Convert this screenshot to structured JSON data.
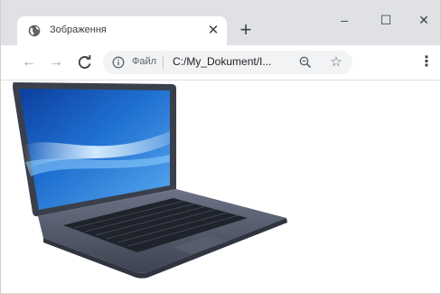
{
  "tab": {
    "title": "Зображення",
    "close_icon": "close-icon",
    "favicon": "globe-icon"
  },
  "new_tab_label": "+",
  "window_controls": {
    "minimize": "–",
    "maximize": "☐",
    "close": "✕"
  },
  "toolbar": {
    "back": "←",
    "forward": "→",
    "reload": "C",
    "scheme_label": "Файл",
    "url": "C:/My_Dokument/I...",
    "star": "☆",
    "menu": "⋮"
  },
  "content": {
    "image_subject": "laptop-image"
  },
  "colors": {
    "tabstrip": "#dfe1e5",
    "omnibox": "#f1f3f4",
    "screen_blue": "#1f6fd0"
  }
}
